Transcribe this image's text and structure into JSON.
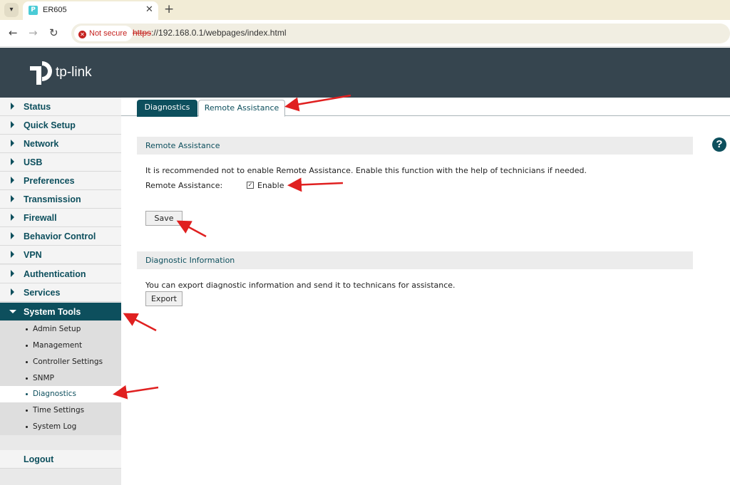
{
  "browser": {
    "tab_title": "ER605",
    "tab_close": "✕",
    "new_tab": "+",
    "not_secure": "Not secure",
    "url_scheme": "https",
    "url_rest": "://192.168.0.1/webpages/index.html"
  },
  "header": {
    "logo_text": "tp-link"
  },
  "sidebar": {
    "items": [
      {
        "label": "Status"
      },
      {
        "label": "Quick Setup"
      },
      {
        "label": "Network"
      },
      {
        "label": "USB"
      },
      {
        "label": "Preferences"
      },
      {
        "label": "Transmission"
      },
      {
        "label": "Firewall"
      },
      {
        "label": "Behavior Control"
      },
      {
        "label": "VPN"
      },
      {
        "label": "Authentication"
      },
      {
        "label": "Services"
      },
      {
        "label": "System Tools"
      }
    ],
    "sub_items": [
      {
        "label": "Admin Setup"
      },
      {
        "label": "Management"
      },
      {
        "label": "Controller Settings"
      },
      {
        "label": "SNMP"
      },
      {
        "label": "Diagnostics"
      },
      {
        "label": "Time Settings"
      },
      {
        "label": "System Log"
      }
    ],
    "logout": "Logout"
  },
  "tabs": [
    {
      "label": "Diagnostics"
    },
    {
      "label": "Remote Assistance"
    }
  ],
  "remote_assistance": {
    "section_title": "Remote Assistance",
    "note": "It is recommended not to enable Remote Assistance. Enable this function with the help of technicians if needed.",
    "field_label": "Remote Assistance:",
    "checkbox_label": "Enable",
    "checked": true,
    "save_label": "Save"
  },
  "diagnostic_info": {
    "section_title": "Diagnostic Information",
    "note": "You can export diagnostic information and send it to technicans for assistance.",
    "export_label": "Export"
  },
  "help_icon": "?",
  "colors": {
    "brand_dark": "#36454f",
    "accent_teal": "#0d4f5d",
    "annotation_red": "#e02020"
  }
}
